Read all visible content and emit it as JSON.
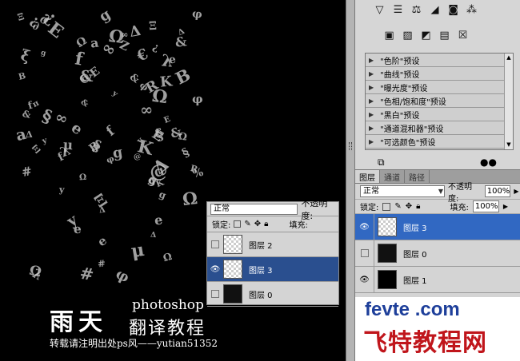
{
  "watermark": {
    "title": "雨天",
    "app": "photoshop",
    "subtitle": "翻译教程",
    "copyright": "转载请注明出处ps风——yutian51352"
  },
  "mini_layers_panel": {
    "blend_mode": "正常",
    "opacity_label": "不透明度:",
    "lock_label": "锁定:",
    "fill_label": "填充:",
    "layers": [
      {
        "name": "图层 2",
        "visible": false,
        "selected": false
      },
      {
        "name": "图层 3",
        "visible": true,
        "selected": true
      },
      {
        "name": "图层 0",
        "visible": false,
        "selected": false
      }
    ]
  },
  "adjustments": {
    "icons_row1": [
      "levels-icon",
      "curves-icon",
      "balance-icon",
      "bw-icon",
      "photo-filter-icon",
      "mixer-icon"
    ],
    "icons_row2": [
      "invert-icon",
      "posterize-icon",
      "threshold-icon",
      "gradient-map-icon",
      "selective-icon"
    ],
    "presets": [
      "\"色阶\"预设",
      "\"曲线\"预设",
      "\"曝光度\"预设",
      "\"色相/饱和度\"预设",
      "\"黑白\"预设",
      "\"通道混和器\"预设",
      "\"可选颜色\"预设"
    ]
  },
  "layers_panel": {
    "tabs": [
      "图层",
      "通道",
      "路径"
    ],
    "blend_mode": "正常",
    "opacity_label": "不透明度:",
    "opacity": "100%",
    "lock_label": "锁定:",
    "fill_label": "填充:",
    "fill": "100%",
    "layers": [
      {
        "name": "图层 3",
        "visible": true,
        "selected": true
      },
      {
        "name": "图层 0",
        "visible": false,
        "selected": false
      },
      {
        "name": "图层 1",
        "visible": true,
        "selected": false
      }
    ]
  },
  "logo": {
    "line1": "fevte .com",
    "line2": "飞特教程网"
  },
  "colors": {
    "selection_blue": "#3168c2",
    "logo_blue": "#1e3f9a",
    "logo_red": "#c0151b"
  }
}
